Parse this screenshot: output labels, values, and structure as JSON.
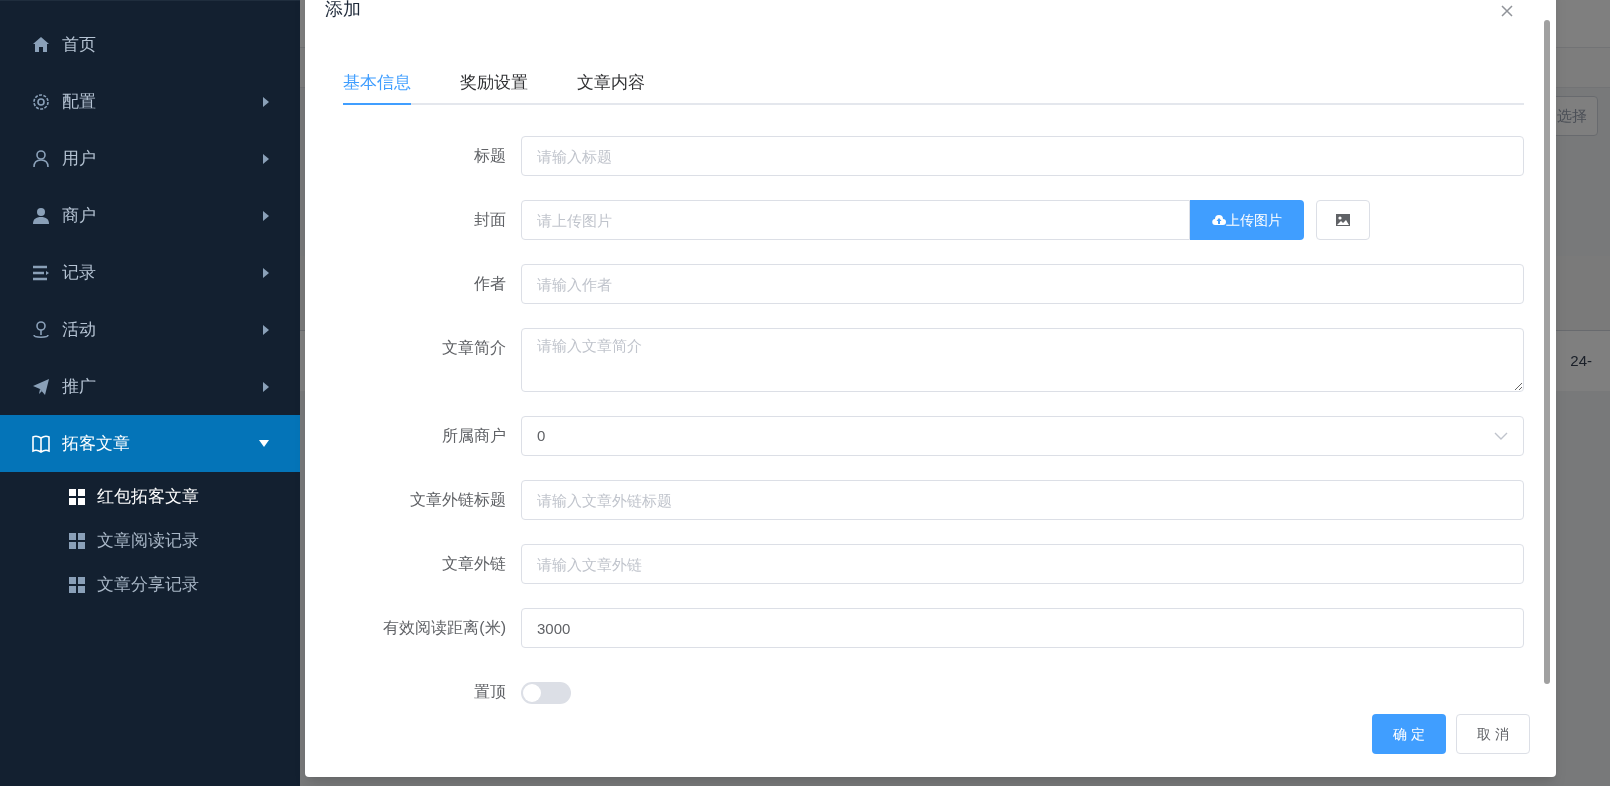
{
  "sidebar": {
    "items": [
      {
        "label": "首页",
        "selected": false
      },
      {
        "label": "配置",
        "expanded": false,
        "selected": false
      },
      {
        "label": "用户",
        "expanded": false,
        "selected": false
      },
      {
        "label": "商户",
        "expanded": false,
        "selected": false
      },
      {
        "label": "记录",
        "expanded": false,
        "selected": false
      },
      {
        "label": "活动",
        "expanded": false,
        "selected": false
      },
      {
        "label": "推广",
        "expanded": false,
        "selected": false
      },
      {
        "label": "拓客文章",
        "expanded": true,
        "selected": true,
        "children": [
          {
            "label": "红包拓客文章",
            "selected": true
          },
          {
            "label": "文章阅读记录",
            "selected": false
          },
          {
            "label": "文章分享记录",
            "selected": false
          }
        ]
      }
    ]
  },
  "background": {
    "search_text": "选择",
    "cell_text": "24-"
  },
  "dialog": {
    "title": "添加",
    "tabs": [
      {
        "label": "基本信息",
        "selected": true
      },
      {
        "label": "奖励设置",
        "selected": false
      },
      {
        "label": "文章内容",
        "selected": false
      }
    ],
    "fields": [
      {
        "label": "标题",
        "kind": "input",
        "placeholder": "请输入标题"
      },
      {
        "label": "封面",
        "kind": "upload",
        "placeholder": "请上传图片",
        "button": "上传图片"
      },
      {
        "label": "作者",
        "kind": "input",
        "placeholder": "请输入作者"
      },
      {
        "label": "文章简介",
        "kind": "textarea",
        "placeholder": "请输入文章简介"
      },
      {
        "label": "所属商户",
        "kind": "select",
        "value": "0"
      },
      {
        "label": "文章外链标题",
        "kind": "input",
        "placeholder": "请输入文章外链标题"
      },
      {
        "label": "文章外链",
        "kind": "input",
        "placeholder": "请输入文章外链"
      },
      {
        "label": "有效阅读距离(米)",
        "kind": "input",
        "value": "3000"
      },
      {
        "label": "置顶",
        "kind": "switch",
        "on": false
      }
    ],
    "buttons": [
      {
        "label": "确 定",
        "primary": true
      },
      {
        "label": "取 消",
        "primary": false
      }
    ]
  }
}
